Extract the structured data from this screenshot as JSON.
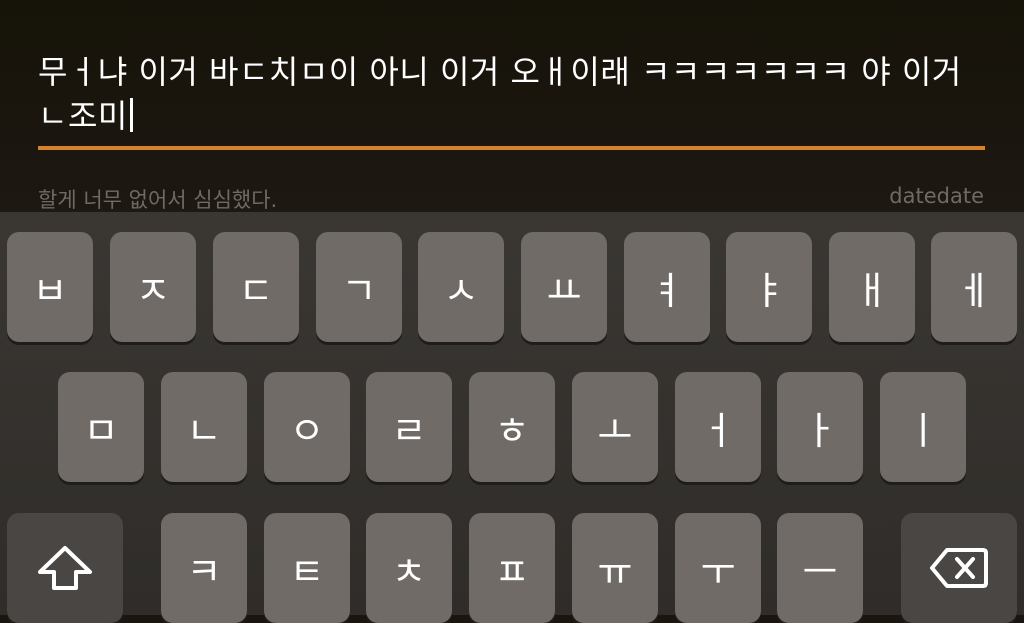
{
  "editor": {
    "typed_line": "무ㅓ냐 이거 바ㄷ치ㅁ이 아니 이거 오ㅐ이래 ㅋㅋㅋㅋㅋㅋㅋ 야 이거ㄴ조미",
    "previous_entry": "할게 너무 없어서 심심했다.",
    "date_label": "datedate",
    "accent_color": "#d1842c"
  },
  "keyboard": {
    "row1": [
      "ㅂ",
      "ㅈ",
      "ㄷ",
      "ㄱ",
      "ㅅ",
      "ㅛ",
      "ㅕ",
      "ㅑ",
      "ㅐ",
      "ㅔ"
    ],
    "row2": [
      "ㅁ",
      "ㄴ",
      "ㅇ",
      "ㄹ",
      "ㅎ",
      "ㅗ",
      "ㅓ",
      "ㅏ",
      "ㅣ"
    ],
    "row3": [
      "ㅋ",
      "ㅌ",
      "ㅊ",
      "ㅍ",
      "ㅠ",
      "ㅜ",
      "ㅡ"
    ],
    "shift_icon": "shift-arrow-icon",
    "delete_icon": "backspace-icon"
  }
}
